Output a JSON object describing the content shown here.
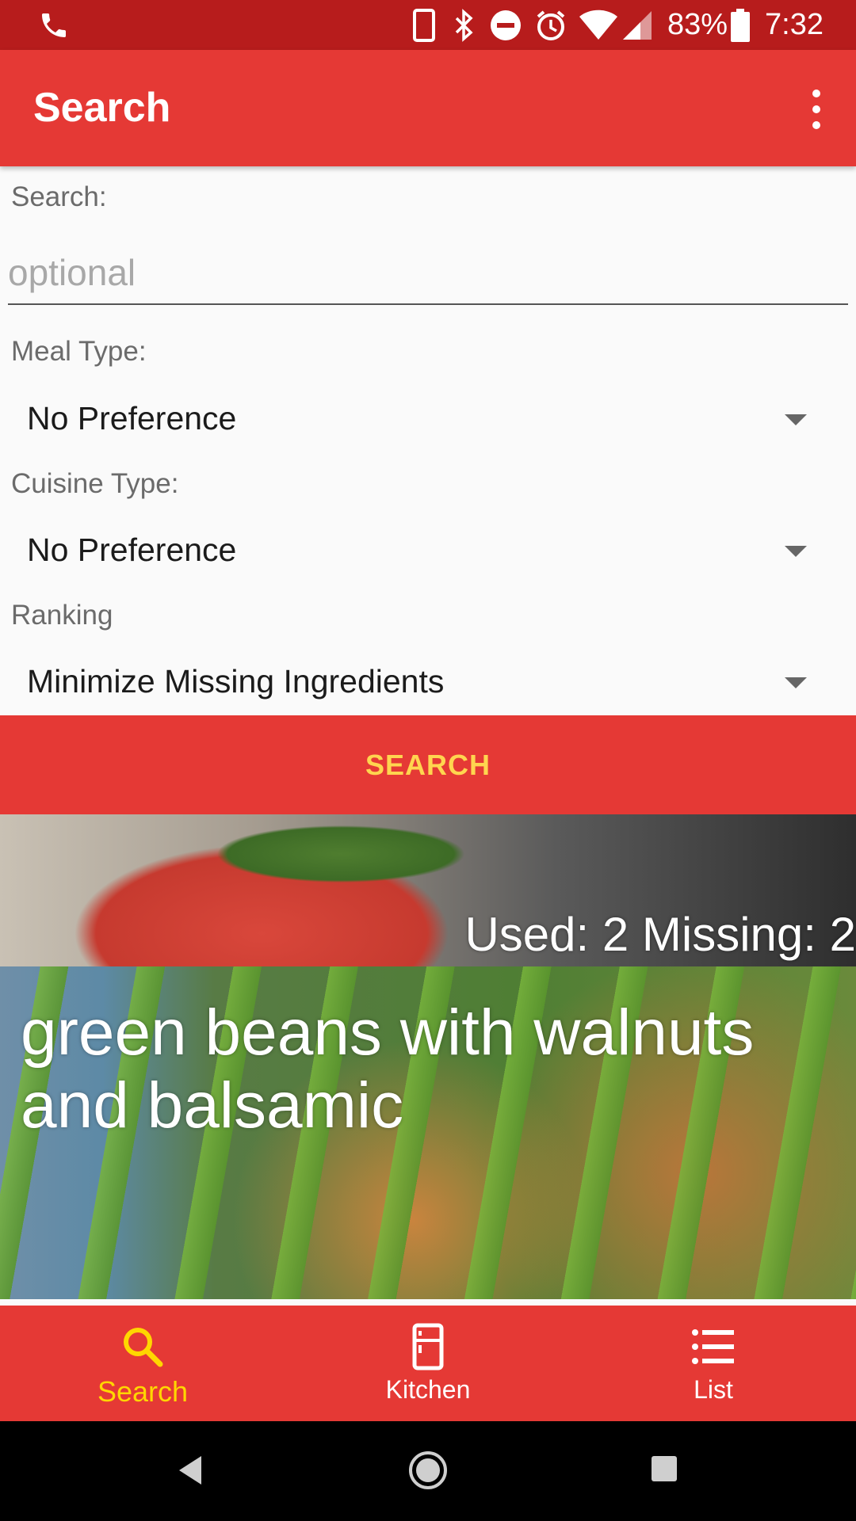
{
  "status_bar": {
    "battery": "83%",
    "time": "7:32",
    "icons": [
      "phone-call-icon",
      "device-icon",
      "bluetooth-icon",
      "do-not-disturb-icon",
      "alarm-icon",
      "wifi-icon",
      "cell-signal-icon",
      "battery-icon"
    ]
  },
  "app_bar": {
    "title": "Search",
    "menu_icon": "more-vert-icon"
  },
  "form": {
    "search_label": "Search:",
    "search_value": "",
    "search_placeholder": "optional",
    "meal_type_label": "Meal Type:",
    "meal_type_value": "No Preference",
    "cuisine_type_label": "Cuisine Type:",
    "cuisine_type_value": "No Preference",
    "ranking_label": "Ranking",
    "ranking_value": "Minimize Missing Ingredients",
    "search_button": "SEARCH"
  },
  "results": [
    {
      "used_missing": "Used: 2 Missing: 2"
    },
    {
      "title": "green beans with walnuts and balsamic"
    }
  ],
  "bottom_nav": {
    "items": [
      {
        "label": "Search",
        "icon": "search-icon",
        "active": true
      },
      {
        "label": "Kitchen",
        "icon": "fridge-icon",
        "active": false
      },
      {
        "label": "List",
        "icon": "list-icon",
        "active": false
      }
    ]
  },
  "system_nav": {
    "icons": [
      "back-icon",
      "home-icon",
      "recents-icon"
    ]
  },
  "colors": {
    "primary": "#e53935",
    "primary_dark": "#b71c1c",
    "accent": "#ffd600"
  }
}
